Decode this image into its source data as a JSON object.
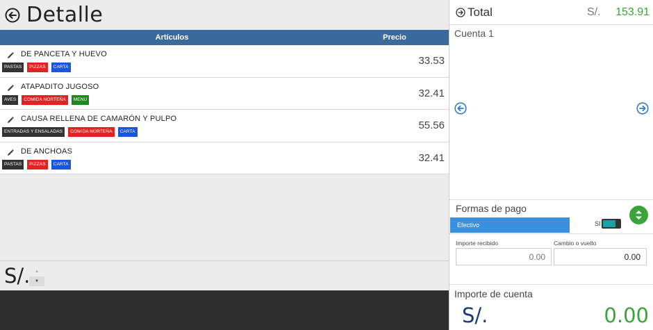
{
  "header": {
    "title": "Detalle"
  },
  "table": {
    "columns": {
      "articles": "Artículos",
      "price": "Precio"
    },
    "rows": [
      {
        "name": "DE PANCETA Y HUEVO",
        "price": "33.53",
        "tags": [
          {
            "label": "PASTAS",
            "color": "#333333"
          },
          {
            "label": "PIZZAS",
            "color": "#e52222"
          },
          {
            "label": "CARTA",
            "color": "#1a55e0"
          }
        ]
      },
      {
        "name": "ATAPADITO JUGOSO",
        "price": "32.41",
        "tags": [
          {
            "label": "AVES",
            "color": "#333333"
          },
          {
            "label": "COMIDA NORTEÑA",
            "color": "#e52222"
          },
          {
            "label": "MENU",
            "color": "#1e8a1e"
          }
        ]
      },
      {
        "name": "CAUSA RELLENA DE CAMARÓN Y PULPO",
        "price": "55.56",
        "tags": [
          {
            "label": "ENTRADAS Y ENSALADAS",
            "color": "#333333"
          },
          {
            "label": "COMIDA NORTEÑA",
            "color": "#e52222"
          },
          {
            "label": "CARTA",
            "color": "#1a55e0"
          }
        ]
      },
      {
        "name": "DE ANCHOAS",
        "price": "32.41",
        "tags": [
          {
            "label": "PASTAS",
            "color": "#333333"
          },
          {
            "label": "PIZZAS",
            "color": "#e52222"
          },
          {
            "label": "CARTA",
            "color": "#1a55e0"
          }
        ]
      }
    ]
  },
  "footer": {
    "currency": "S/."
  },
  "summary": {
    "total_label": "Total",
    "currency": "S/.",
    "total_amount": "153.91",
    "account_name": "Cuenta 1"
  },
  "payment": {
    "title": "Formas de pago",
    "method": "Efectivo",
    "si_label": "SI",
    "received_label": "Importe recibido",
    "received_value": "0.00",
    "change_label": "Cambio o vuelto",
    "change_value": "0.00"
  },
  "account_amount": {
    "title": "Importe de cuenta",
    "currency": "S/.",
    "amount": "0.00"
  },
  "colors": {
    "accent_blue": "#3a6a9b",
    "green": "#3aa43a",
    "method_blue": "#3c8fdc"
  }
}
